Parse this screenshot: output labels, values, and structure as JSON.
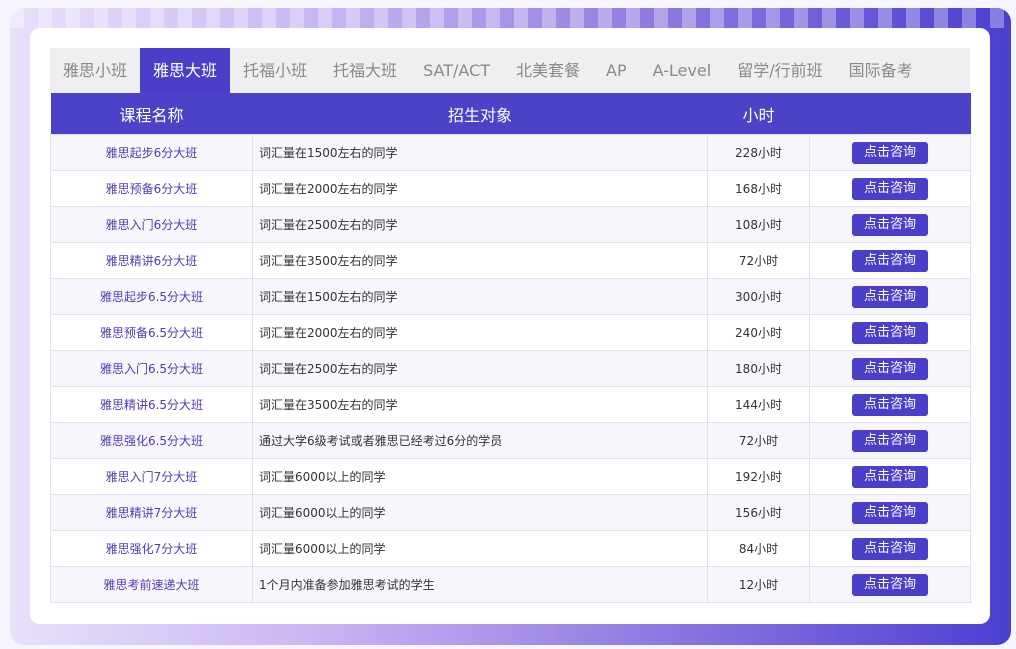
{
  "tabs": [
    {
      "label": "雅思小班",
      "active": false
    },
    {
      "label": "雅思大班",
      "active": true
    },
    {
      "label": "托福小班",
      "active": false
    },
    {
      "label": "托福大班",
      "active": false
    },
    {
      "label": "SAT/ACT",
      "active": false
    },
    {
      "label": "北美套餐",
      "active": false
    },
    {
      "label": "AP",
      "active": false
    },
    {
      "label": "A-Level",
      "active": false
    },
    {
      "label": "留学/行前班",
      "active": false
    },
    {
      "label": "国际备考",
      "active": false
    }
  ],
  "table": {
    "headers": {
      "name": "课程名称",
      "target": "招生对象",
      "hours": "小时",
      "action": ""
    },
    "rows": [
      {
        "name": "雅思起步6分大班",
        "target": "词汇量在1500左右的同学",
        "hours": "228小时",
        "action": "点击咨询"
      },
      {
        "name": "雅思预备6分大班",
        "target": "词汇量在2000左右的同学",
        "hours": "168小时",
        "action": "点击咨询"
      },
      {
        "name": "雅思入门6分大班",
        "target": "词汇量在2500左右的同学",
        "hours": "108小时",
        "action": "点击咨询"
      },
      {
        "name": "雅思精讲6分大班",
        "target": "词汇量在3500左右的同学",
        "hours": "72小时",
        "action": "点击咨询"
      },
      {
        "name": "雅思起步6.5分大班",
        "target": "词汇量在1500左右的同学",
        "hours": "300小时",
        "action": "点击咨询"
      },
      {
        "name": "雅思预备6.5分大班",
        "target": "词汇量在2000左右的同学",
        "hours": "240小时",
        "action": "点击咨询"
      },
      {
        "name": "雅思入门6.5分大班",
        "target": "词汇量在2500左右的同学",
        "hours": "180小时",
        "action": "点击咨询"
      },
      {
        "name": "雅思精讲6.5分大班",
        "target": "词汇量在3500左右的同学",
        "hours": "144小时",
        "action": "点击咨询"
      },
      {
        "name": "雅思强化6.5分大班",
        "target": "通过大学6级考试或者雅思已经考过6分的学员",
        "hours": "72小时",
        "action": "点击咨询"
      },
      {
        "name": "雅思入门7分大班",
        "target": "词汇量6000以上的同学",
        "hours": "192小时",
        "action": "点击咨询"
      },
      {
        "name": "雅思精讲7分大班",
        "target": "词汇量6000以上的同学",
        "hours": "156小时",
        "action": "点击咨询"
      },
      {
        "name": "雅思强化7分大班",
        "target": "词汇量6000以上的同学",
        "hours": "84小时",
        "action": "点击咨询"
      },
      {
        "name": "雅思考前速递大班",
        "target": "1个月内准备参加雅思考试的学生",
        "hours": "12小时",
        "action": "点击咨询"
      }
    ]
  },
  "colors": {
    "accent": "#4b3fc9",
    "header_bg": "#4b42c8",
    "tab_bar_bg": "#efeff1",
    "course_name_text": "#4a3fb3"
  }
}
